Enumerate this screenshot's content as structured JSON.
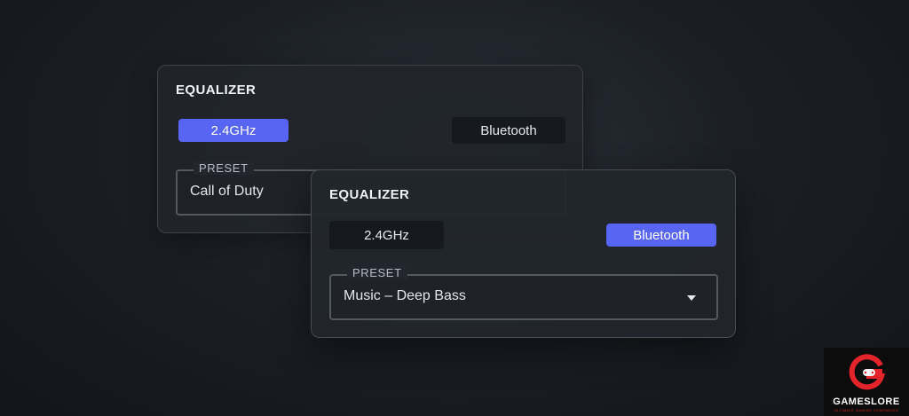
{
  "colors": {
    "accent": "#5865f2",
    "background": "#1b1f25",
    "panel": "#23272d",
    "logo_red": "#e3242b"
  },
  "panel_back": {
    "title": "EQUALIZER",
    "connection_options": [
      "2.4GHz",
      "Bluetooth"
    ],
    "selected_connection": "2.4GHz",
    "preset_label": "PRESET",
    "preset_value": "Call of Duty"
  },
  "panel_front": {
    "title": "EQUALIZER",
    "connection_options": [
      "2.4GHz",
      "Bluetooth"
    ],
    "selected_connection": "Bluetooth",
    "preset_label": "PRESET",
    "preset_value": "Music – Deep Bass",
    "dropdown_icon": "caret-down-icon"
  },
  "watermark": {
    "brand": "GAMESLORE",
    "tagline": "ULTIMATE GAMING COMPANION",
    "icon": "gameslore-logo-icon"
  }
}
